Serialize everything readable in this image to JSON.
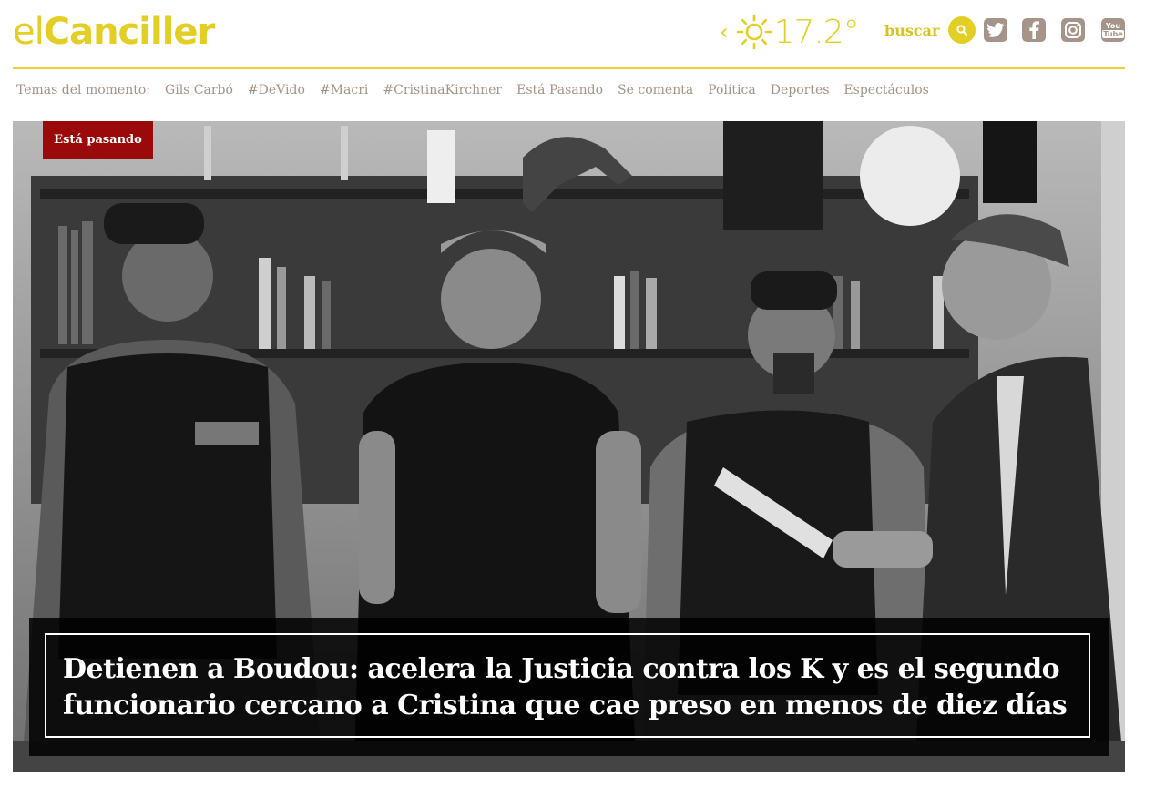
{
  "header": {
    "logo_prefix": "el",
    "logo_main": "Canciller",
    "weather": {
      "temperature": "17.2°",
      "icon": "sun-icon"
    },
    "search_label": "buscar"
  },
  "social": [
    {
      "name": "twitter",
      "icon": "twitter-icon"
    },
    {
      "name": "facebook",
      "icon": "facebook-icon"
    },
    {
      "name": "instagram",
      "icon": "instagram-icon"
    },
    {
      "name": "youtube",
      "icon": "youtube-icon",
      "label_top": "You",
      "label_bottom": "Tube"
    }
  ],
  "nav": {
    "lead": "Temas del momento:",
    "items": [
      "Gils Carbó",
      "#DeVido",
      "#Macri",
      "#CristinaKirchner",
      "Está Pasando",
      "Se comenta",
      "Política",
      "Deportes",
      "Espectáculos"
    ]
  },
  "hero": {
    "badge": "Está pasando",
    "headline_line1": "Detienen a Boudou: acelera la Justicia contra los K y es el segundo",
    "headline_line2": "funcionario cercano a Cristina que cae preso en menos de diez días"
  },
  "colors": {
    "accent": "#e3cf24",
    "badge": "#9b0a0a",
    "nav_text": "#a59389",
    "social_bg": "#a6938a"
  }
}
